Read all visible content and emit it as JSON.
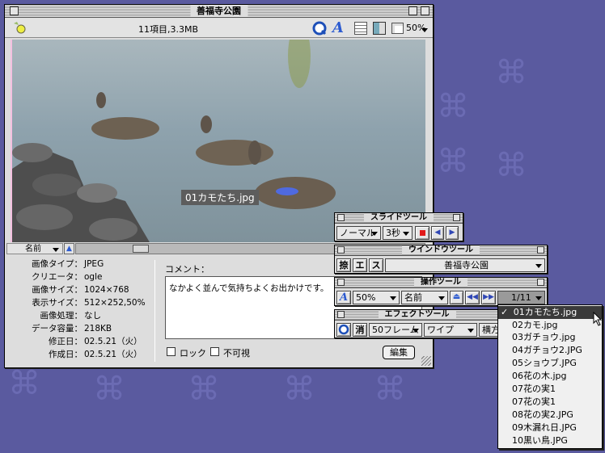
{
  "main_window": {
    "title": "善福寺公園",
    "status": "11項目,3.3MB",
    "zoom": "50%",
    "caption": "01カモたち.jpg",
    "sort": "名前",
    "info": [
      {
        "label": "画像タイプ：",
        "value": "JPEG"
      },
      {
        "label": "クリエータ：",
        "value": "ogle"
      },
      {
        "label": "画像サイズ：",
        "value": "1024×768"
      },
      {
        "label": "表示サイズ：",
        "value": "512×252,50%"
      },
      {
        "label": "画像処理：",
        "value": "なし"
      },
      {
        "label": "データ容量：",
        "value": "218KB"
      },
      {
        "label": "修正日：",
        "value": "02.5.21（火）"
      },
      {
        "label": "作成日：",
        "value": "02.5.21（火）"
      }
    ],
    "comment_label": "コメント：",
    "comment_text": "なかよく並んで気持ちよくお出かけです。",
    "lock_label": "ロック",
    "invisible_label": "不可視",
    "edit_button": "編集"
  },
  "slide_tool": {
    "title": "スライドツール",
    "mode": "ノーマル",
    "interval": "3秒"
  },
  "window_tool": {
    "title": "ウインドウツール",
    "btn1": "捺",
    "btn2": "エ",
    "btn3": "ス",
    "folder": "善福寺公園"
  },
  "operation_tool": {
    "title": "操作ツール",
    "zoom": "50%",
    "sort": "名前",
    "counter": "1/11"
  },
  "effect_tool": {
    "title": "エフェクトツール",
    "erase": "消",
    "frames": "50フレーム",
    "effect": "ワイプ",
    "direction": "横方"
  },
  "file_menu": {
    "items": [
      "01カモたち.jpg",
      "02カモ.jpg",
      "03ガチョウ.jpg",
      "04ガチョウ2.JPG",
      "05ショウブ.JPG",
      "06花の木.jpg",
      "07花の実1",
      "07花の実1",
      "08花の実2.JPG",
      "09木漏れ日.JPG",
      "10黒い鳥.JPG"
    ],
    "selected_index": 0,
    "check": "✓"
  },
  "colors": {
    "desktop": "#5a5a9f",
    "window": "#dddddd",
    "highlight": "#3a3a3a",
    "accent": "#2c5bd0"
  }
}
